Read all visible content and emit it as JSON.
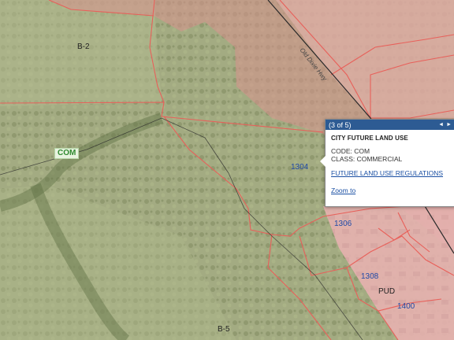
{
  "zones": {
    "b2": "B-2",
    "b5": "B-5",
    "com": "COM",
    "pud": "PUD"
  },
  "parcels": {
    "p1304": "1304",
    "p1306": "1306",
    "p1308": "1308",
    "p1400": "1400"
  },
  "road": "Old Dixie Hwy",
  "popup": {
    "counter": "(3 of 5)",
    "prev": "◄",
    "next": "►",
    "title": "CITY FUTURE LAND USE",
    "code": "CODE: COM",
    "class": "CLASS: COMMERCIAL",
    "link_regulations": "FUTURE LAND USE REGULATIONS",
    "link_zoom": "Zoom to"
  },
  "colors": {
    "forest": "#8f9b6f",
    "forest_highlight": "#a7b084",
    "commercial_tint": "#d98e8a",
    "residential_pink": "#e2a8a8",
    "parcel_line": "#e8605a",
    "road_line": "#2a2a2a",
    "popup_header": "#2d5b93"
  }
}
